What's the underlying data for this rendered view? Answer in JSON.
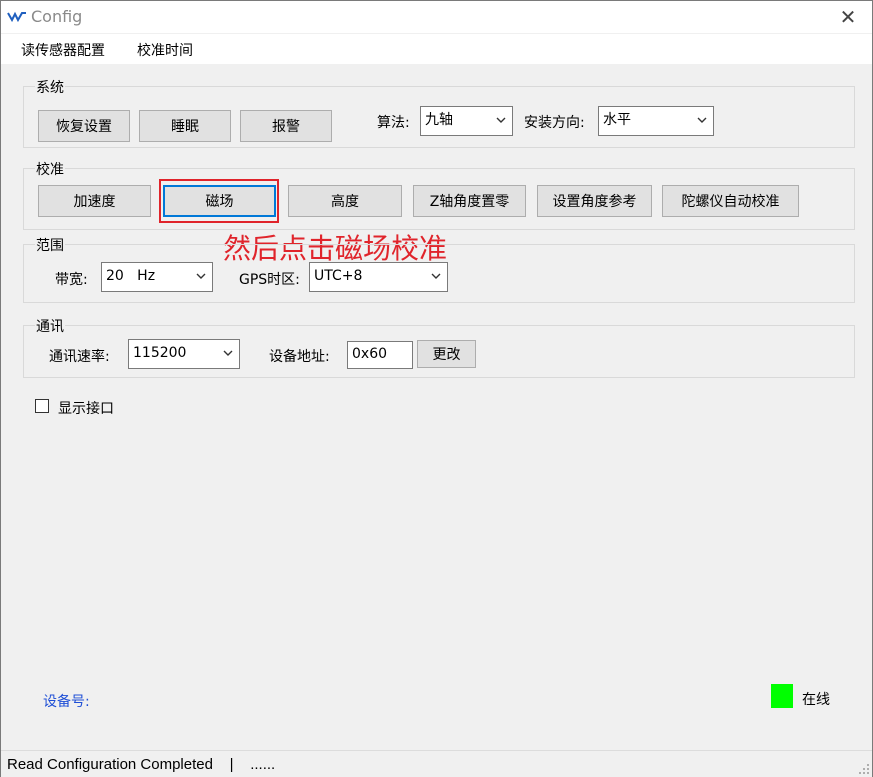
{
  "window": {
    "title": "Config",
    "app_icon": "wt-logo-icon",
    "close_icon": "close-icon"
  },
  "menu": {
    "items": [
      "读传感器配置",
      "校准时间"
    ]
  },
  "system": {
    "label": "系统",
    "buttons": [
      "恢复设置",
      "睡眠",
      "报警"
    ],
    "algorithm_label": "算法:",
    "algorithm_value": "九轴",
    "orientation_label": "安装方向:",
    "orientation_value": "水平"
  },
  "calibration": {
    "label": "校准",
    "buttons": [
      "加速度",
      "磁场",
      "高度",
      "Z轴角度置零",
      "设置角度参考",
      "陀螺仪自动校准"
    ]
  },
  "annotation": {
    "text": "然后点击磁场校准",
    "color": "#e0242b"
  },
  "range": {
    "label": "范围",
    "bandwidth_label": "带宽:",
    "bandwidth_value": "20   Hz",
    "timezone_label": "GPS时区:",
    "timezone_value": "UTC+8"
  },
  "comm": {
    "label": "通讯",
    "baud_label": "通讯速率:",
    "baud_value": "115200",
    "address_label": "设备地址:",
    "address_value": "0x60",
    "change_button": "更改"
  },
  "show_interface": {
    "label": "显示接口",
    "checked": false
  },
  "device": {
    "label": "设备号:",
    "color": "#1f4fd6"
  },
  "status": {
    "online_label": "在线",
    "indicator_color": "#00ff00"
  },
  "statusbar": {
    "text": "Read Configuration Completed    |    ......"
  }
}
